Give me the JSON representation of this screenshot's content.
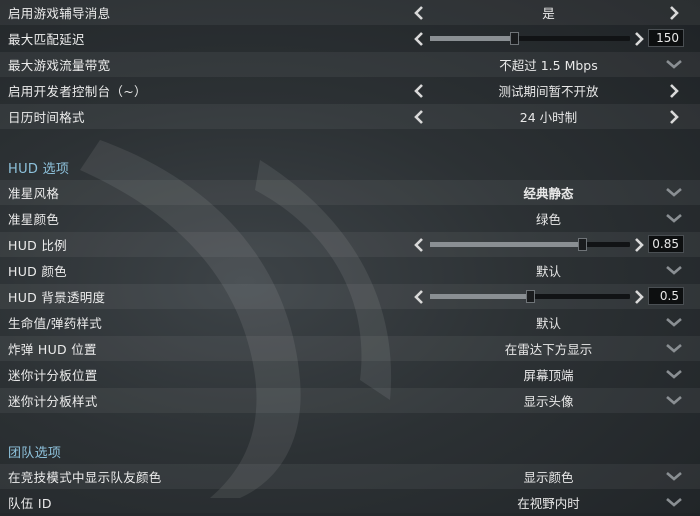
{
  "general": [
    {
      "label": "启用游戏辅导消息",
      "control": "arrows",
      "value": "是"
    },
    {
      "label": "最大匹配延迟",
      "control": "slider",
      "value": "150",
      "level": 0.42
    },
    {
      "label": "最大游戏流量带宽",
      "control": "dropdown",
      "value": "不超过 1.5 Mbps"
    },
    {
      "label": "启用开发者控制台（~）",
      "control": "arrows",
      "value": "测试期间暂不开放"
    },
    {
      "label": "日历时间格式",
      "control": "arrows",
      "value": "24 小时制"
    }
  ],
  "hud_section": {
    "title": "HUD 选项",
    "rows": [
      {
        "label": "准星风格",
        "control": "dropdown",
        "value": "经典静态"
      },
      {
        "label": "准星颜色",
        "control": "dropdown",
        "value": "绿色"
      },
      {
        "label": "HUD 比例",
        "control": "slider",
        "value": "0.85",
        "level": 0.76
      },
      {
        "label": "HUD 颜色",
        "control": "dropdown",
        "value": "默认"
      },
      {
        "label": "HUD 背景透明度",
        "control": "slider",
        "value": "0.5",
        "level": 0.5
      },
      {
        "label": "生命值/弹药样式",
        "control": "dropdown",
        "value": "默认"
      },
      {
        "label": "炸弹 HUD 位置",
        "control": "dropdown",
        "value": "在雷达下方显示"
      },
      {
        "label": "迷你计分板位置",
        "control": "dropdown",
        "value": "屏幕顶端"
      },
      {
        "label": "迷你计分板样式",
        "control": "dropdown",
        "value": "显示头像"
      }
    ]
  },
  "team_section": {
    "title": "团队选项",
    "rows": [
      {
        "label": "在竞技模式中显示队友颜色",
        "control": "dropdown",
        "value": "显示颜色"
      },
      {
        "label": "队伍 ID",
        "control": "dropdown",
        "value": "在视野内时"
      }
    ]
  },
  "colors": {
    "section_title": "#8ec2dc",
    "row_stripe": "rgba(255,255,255,0.055)",
    "background": "#2c3134"
  },
  "icons": {
    "left": "chevron-left-icon",
    "right": "chevron-right-icon",
    "dropdown": "chevron-down-icon"
  }
}
